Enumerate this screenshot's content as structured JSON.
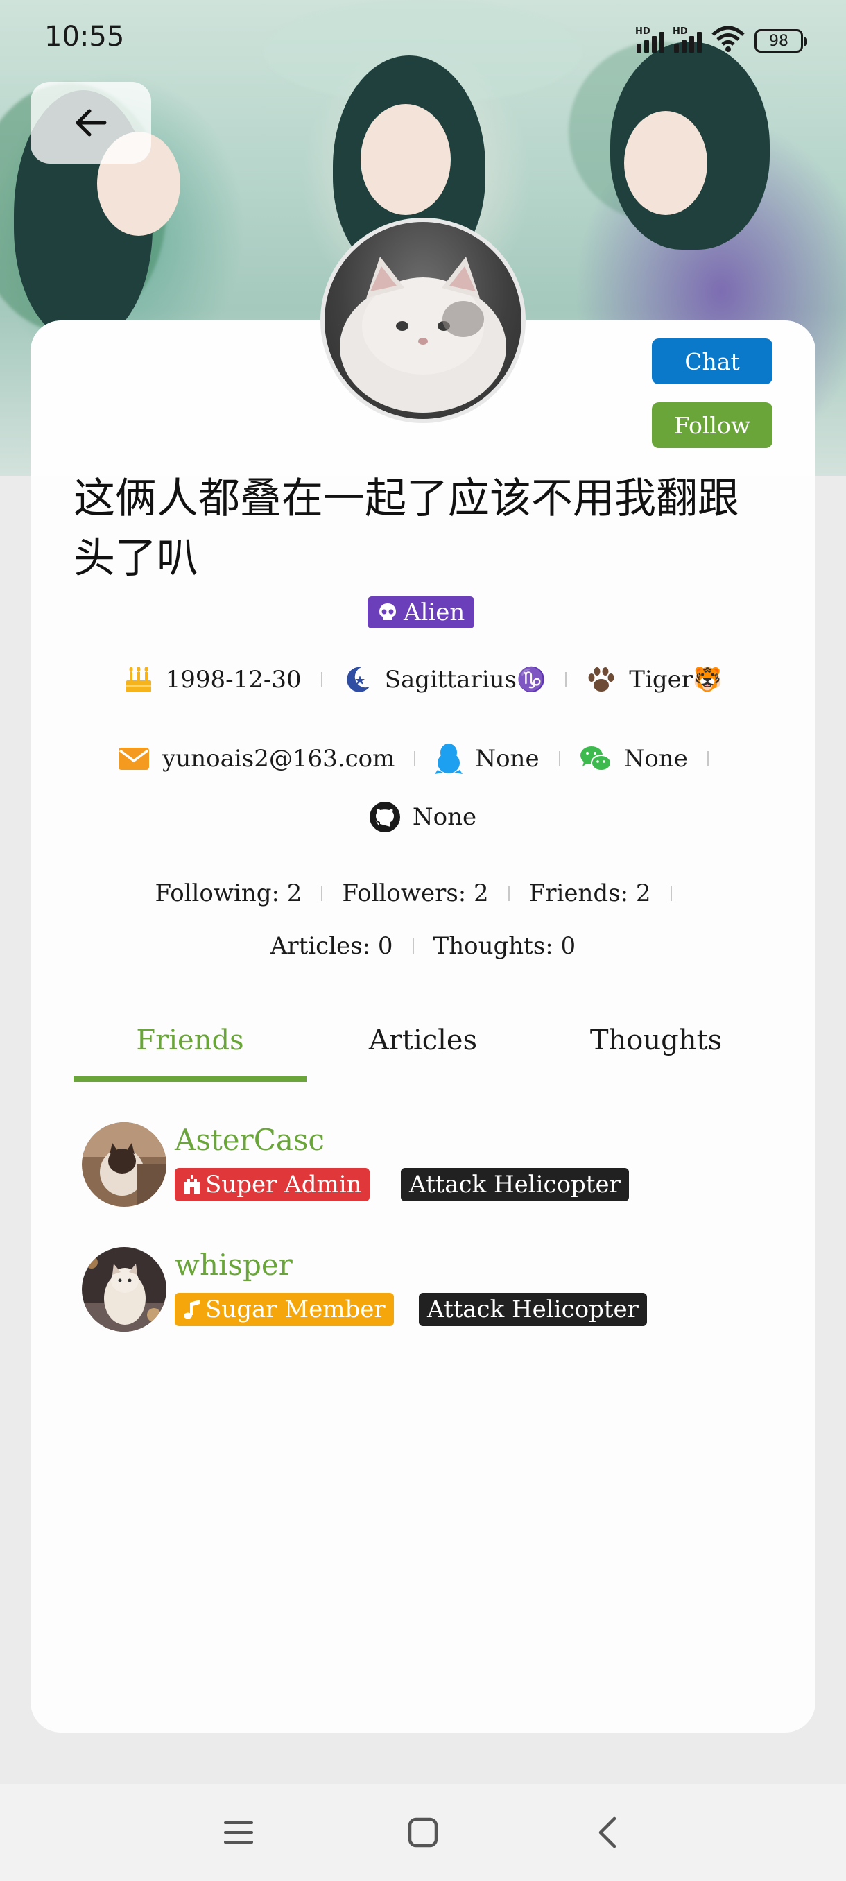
{
  "status_bar": {
    "time": "10:55",
    "battery": "98",
    "network_labels": [
      "HD",
      "HD"
    ]
  },
  "profile": {
    "username": "这俩人都叠在一起了应该不用我翻跟头了叭",
    "level_badge": "Alien",
    "chat_label": "Chat",
    "follow_label": "Follow",
    "birthday": "1998-12-30",
    "zodiac": "Sagittarius♑",
    "chinese_zodiac": "Tiger🐯",
    "email": "yunoais2@163.com",
    "qq": "None",
    "wechat": "None",
    "github": "None"
  },
  "stats": {
    "following": "Following: 2",
    "followers": "Followers: 2",
    "friends": "Friends: 2",
    "articles": "Articles: 0",
    "thoughts": "Thoughts: 0"
  },
  "tabs": [
    {
      "label": "Friends",
      "active": true
    },
    {
      "label": "Articles",
      "active": false
    },
    {
      "label": "Thoughts",
      "active": false
    }
  ],
  "friends": [
    {
      "name": "AsterCasc",
      "role": "Super Admin",
      "title": "Attack Helicopter",
      "role_color": "#e0383a"
    },
    {
      "name": "whisper",
      "role": "Sugar Member",
      "title": "Attack Helicopter",
      "role_color": "#f5a60b"
    }
  ],
  "colors": {
    "accent_green": "#6aa53a",
    "chat_blue": "#0a79c9",
    "alien_purple": "#6a3fb9"
  },
  "icons": {
    "back": "arrow-left-icon",
    "birthday": "cake-icon",
    "zodiac": "moon-star-icon",
    "chinese_zodiac": "paw-icon",
    "email": "envelope-icon",
    "qq": "penguin-icon",
    "wechat": "wechat-icon",
    "github": "github-icon"
  }
}
